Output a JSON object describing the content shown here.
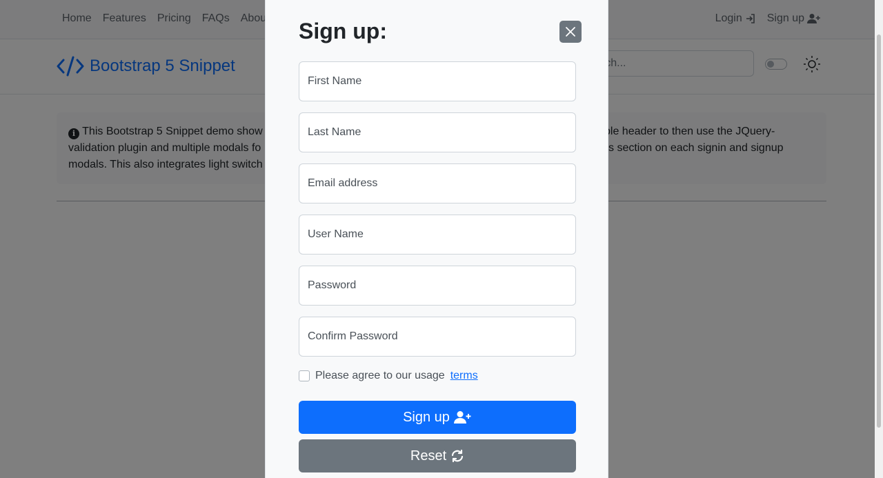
{
  "nav": {
    "links": [
      "Home",
      "Features",
      "Pricing",
      "FAQs",
      "Abou"
    ],
    "login": "Login",
    "signup": "Sign up"
  },
  "header": {
    "brand": "Bootstrap 5 Snippet",
    "search_placeholder": "arch..."
  },
  "alert": {
    "line1_left": "This Bootstrap 5 Snippet demo show",
    "line1_right": "ple header to then use the JQuery-",
    "line2_left": "validation plugin and multiple modals fo",
    "line2_right": "s section on each signin and signup",
    "line3_left": "modals. This also integrates light switch"
  },
  "modal": {
    "title": "Sign up:",
    "fields": {
      "first_name": "First Name",
      "last_name": "Last Name",
      "email": "Email address",
      "username": "User Name",
      "password": "Password",
      "confirm_password": "Confirm Password"
    },
    "agree_text": "Please agree to our usage",
    "terms_link": "terms",
    "submit_label": "Sign up",
    "reset_label": "Reset"
  },
  "colors": {
    "primary": "#0d6efd",
    "secondary": "#6c757d",
    "modal_bg": "#f8f9fa"
  }
}
